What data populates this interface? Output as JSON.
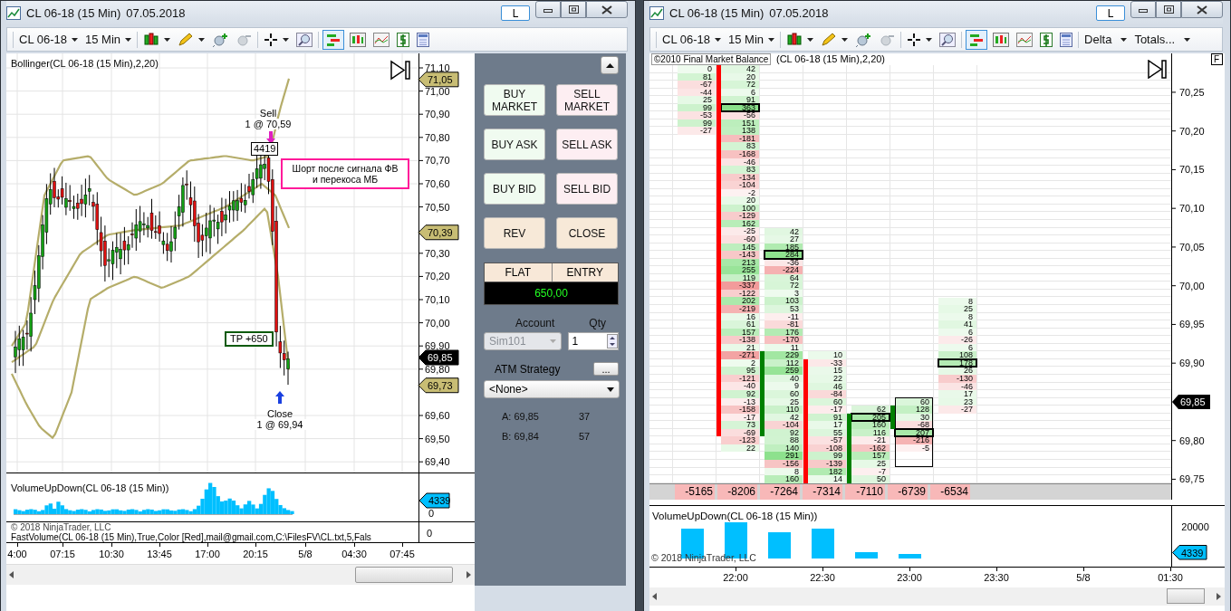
{
  "left_window": {
    "title": "CL 06-18 (15 Min)",
    "date": "07.05.2018",
    "layout_button": "L",
    "toolbar": {
      "instrument": "CL 06-18",
      "interval": "15 Min"
    },
    "price_panel": {
      "indicator": "Bollinger(CL 06-18 (15 Min),2,20)",
      "axis_labels": [
        "71,10",
        "71,00",
        "70,90",
        "70,80",
        "70,70",
        "70,60",
        "70,50",
        "70,30",
        "70,20",
        "70,10",
        "70,00",
        "69,90",
        "69,80",
        "69,60",
        "69,50",
        "69,40"
      ],
      "price_tags": [
        {
          "text": "71,05",
          "color": "#c8bd74"
        },
        {
          "text": "70,39",
          "color": "#c8bd74"
        },
        {
          "text": "69,85",
          "color": "#000000"
        },
        {
          "text": "69,73",
          "color": "#c8bd74"
        }
      ],
      "trades": [
        {
          "kind": "sell",
          "action": "Sell",
          "fill": "1 @ 70,59"
        },
        {
          "kind": "close",
          "action": "Close",
          "fill": "1 @ 69,94"
        }
      ],
      "volume_box": "4419",
      "note": "Шорт после сигнала ФВ\nи перекоса МБ",
      "target": "TP +650"
    },
    "volume_panel": {
      "label": "VolumeUpDown(CL 06-18 (15 Min))",
      "tag": "4339",
      "zero": "0"
    },
    "fastvolume_panel": {
      "copyright": "© 2018 NinjaTrader, LLC",
      "label": "FastVolume(CL 06-18 (15 Min),True,Color [Red],mail@gmail.com,C:\\FilesFV\\CL.txt,5,Fals",
      "zero": "0"
    },
    "time_axis": [
      "4:00",
      "07:15",
      "10:30",
      "13:45",
      "17:00",
      "20:15",
      "5/8",
      "04:30",
      "07:45"
    ]
  },
  "order_panel": {
    "buttons": [
      {
        "label": "BUY MARKET",
        "kind": "buy"
      },
      {
        "label": "SELL MARKET",
        "kind": "sell"
      },
      {
        "label": "BUY ASK",
        "kind": "buy"
      },
      {
        "label": "SELL ASK",
        "kind": "sell"
      },
      {
        "label": "BUY BID",
        "kind": "buy"
      },
      {
        "label": "SELL BID",
        "kind": "sell"
      },
      {
        "label": "REV",
        "kind": "neutral"
      },
      {
        "label": "CLOSE",
        "kind": "neutral"
      }
    ],
    "position": {
      "status": "FLAT",
      "mode": "ENTRY",
      "pnl": "650,00"
    },
    "account": {
      "label": "Account",
      "value": "Sim101",
      "disabled": true
    },
    "quantity": {
      "label": "Qty",
      "value": "1"
    },
    "atm": {
      "label": "ATM Strategy",
      "more": "...",
      "value": "<None>"
    },
    "quotes": [
      {
        "price": "A: 69,85",
        "size": "37"
      },
      {
        "price": "B: 69,84",
        "size": "57"
      }
    ]
  },
  "right_window": {
    "title": "CL 06-18 (15 Min)",
    "date": "07.05.2018",
    "layout_button": "L",
    "toolbar": {
      "instrument": "CL 06-18",
      "interval": "15 Min",
      "view": "Delta",
      "totals": "Totals..."
    },
    "header": {
      "tooltip": "©2010 Final Market Balance",
      "indicator": "(CL 06-18 (15 Min),2,20)",
      "flag": "F"
    },
    "footprint": {
      "columns": [
        {
          "cells": [
            {
              "text": "0",
              "boxed": false
            },
            {
              "text": "81",
              "boxed": false
            },
            {
              "text": "-67",
              "boxed": false
            },
            {
              "text": "-44",
              "boxed": false
            },
            {
              "text": "25",
              "boxed": false
            },
            {
              "text": "99",
              "boxed": false
            },
            {
              "text": "-53",
              "boxed": false
            },
            {
              "text": "99",
              "boxed": false
            },
            {
              "text": "-27",
              "boxed": false
            }
          ]
        },
        {
          "color": "#ff0000",
          "cells": [
            {
              "text": "42",
              "boxed": false
            },
            {
              "text": "20",
              "boxed": false
            },
            {
              "text": "72",
              "boxed": false
            },
            {
              "text": "6",
              "boxed": false
            },
            {
              "text": "91",
              "boxed": false
            },
            {
              "text": "363",
              "boxed": true
            },
            {
              "text": "-56",
              "boxed": false
            },
            {
              "text": "151",
              "boxed": false
            },
            {
              "text": "138",
              "boxed": false
            },
            {
              "text": "-181",
              "boxed": false
            },
            {
              "text": "83",
              "boxed": false
            },
            {
              "text": "-168",
              "boxed": false
            },
            {
              "text": "-46",
              "boxed": false
            },
            {
              "text": "83",
              "boxed": false
            },
            {
              "text": "-134",
              "boxed": false
            },
            {
              "text": "-104",
              "boxed": false
            },
            {
              "text": "-2",
              "boxed": false
            },
            {
              "text": "20",
              "boxed": false
            },
            {
              "text": "100",
              "boxed": false
            },
            {
              "text": "-129",
              "boxed": false
            },
            {
              "text": "162",
              "boxed": false
            },
            {
              "text": "-25",
              "boxed": false
            },
            {
              "text": "-60",
              "boxed": false
            },
            {
              "text": "145",
              "boxed": false
            },
            {
              "text": "-143",
              "boxed": false
            },
            {
              "text": "213",
              "boxed": false
            },
            {
              "text": "255",
              "boxed": false
            },
            {
              "text": "119",
              "boxed": false
            },
            {
              "text": "-337",
              "boxed": false
            },
            {
              "text": "-122",
              "boxed": false
            },
            {
              "text": "202",
              "boxed": false
            },
            {
              "text": "-219",
              "boxed": false
            },
            {
              "text": "16",
              "boxed": false
            },
            {
              "text": "61",
              "boxed": false
            },
            {
              "text": "157",
              "boxed": false
            },
            {
              "text": "-138",
              "boxed": false
            },
            {
              "text": "21",
              "boxed": false
            },
            {
              "text": "-271",
              "boxed": false
            },
            {
              "text": "2",
              "boxed": false
            },
            {
              "text": "95",
              "boxed": false
            },
            {
              "text": "-121",
              "boxed": false
            },
            {
              "text": "-40",
              "boxed": false
            },
            {
              "text": "92",
              "boxed": false
            },
            {
              "text": "-13",
              "boxed": false
            },
            {
              "text": "-158",
              "boxed": false
            },
            {
              "text": "-17",
              "boxed": false
            },
            {
              "text": "73",
              "boxed": false
            },
            {
              "text": "-69",
              "boxed": false
            },
            {
              "text": "-123",
              "boxed": false
            },
            {
              "text": "22",
              "boxed": false
            }
          ]
        },
        {
          "color": "#008000",
          "cells": [
            {
              "text": "42",
              "boxed": false
            },
            {
              "text": "27",
              "boxed": false
            },
            {
              "text": "185",
              "boxed": false
            },
            {
              "text": "284",
              "boxed": true
            },
            {
              "text": "-36",
              "boxed": false
            },
            {
              "text": "-224",
              "boxed": false
            },
            {
              "text": "64",
              "boxed": false
            },
            {
              "text": "72",
              "boxed": false
            },
            {
              "text": "3",
              "boxed": false
            },
            {
              "text": "103",
              "boxed": false
            },
            {
              "text": "53",
              "boxed": false
            },
            {
              "text": "-11",
              "boxed": false
            },
            {
              "text": "-81",
              "boxed": false
            },
            {
              "text": "176",
              "boxed": false
            },
            {
              "text": "-170",
              "boxed": false
            },
            {
              "text": "11",
              "boxed": false
            },
            {
              "text": "229",
              "boxed": false
            },
            {
              "text": "112",
              "boxed": false
            },
            {
              "text": "259",
              "boxed": false
            },
            {
              "text": "40",
              "boxed": false
            },
            {
              "text": "9",
              "boxed": false
            },
            {
              "text": "60",
              "boxed": false
            },
            {
              "text": "25",
              "boxed": false
            },
            {
              "text": "110",
              "boxed": false
            },
            {
              "text": "42",
              "boxed": false
            },
            {
              "text": "-104",
              "boxed": false
            },
            {
              "text": "92",
              "boxed": false
            },
            {
              "text": "88",
              "boxed": false
            },
            {
              "text": "140",
              "boxed": false
            },
            {
              "text": "291",
              "boxed": false
            },
            {
              "text": "-156",
              "boxed": false
            },
            {
              "text": "8",
              "boxed": false
            },
            {
              "text": "160",
              "boxed": false
            }
          ]
        },
        {
          "color": "#ff0000",
          "cells": [
            {
              "text": "10",
              "boxed": false
            },
            {
              "text": "-33",
              "boxed": false
            },
            {
              "text": "15",
              "boxed": false
            },
            {
              "text": "22",
              "boxed": false
            },
            {
              "text": "46",
              "boxed": false
            },
            {
              "text": "-84",
              "boxed": false
            },
            {
              "text": "60",
              "boxed": false
            },
            {
              "text": "-17",
              "boxed": false
            },
            {
              "text": "91",
              "boxed": false
            },
            {
              "text": "17",
              "boxed": false
            },
            {
              "text": "55",
              "boxed": false
            },
            {
              "text": "-57",
              "boxed": false
            },
            {
              "text": "-108",
              "boxed": false
            },
            {
              "text": "99",
              "boxed": false
            },
            {
              "text": "-139",
              "boxed": false
            },
            {
              "text": "182",
              "boxed": false
            },
            {
              "text": "14",
              "boxed": false
            }
          ]
        },
        {
          "color": "#008000",
          "cells": [
            {
              "text": "62",
              "boxed": false
            },
            {
              "text": "205",
              "boxed": true
            },
            {
              "text": "160",
              "boxed": false
            },
            {
              "text": "116",
              "boxed": false
            },
            {
              "text": "-21",
              "boxed": false
            },
            {
              "text": "-162",
              "boxed": false
            },
            {
              "text": "157",
              "boxed": false
            },
            {
              "text": "25",
              "boxed": false
            },
            {
              "text": "-7",
              "boxed": false
            },
            {
              "text": "50",
              "boxed": false
            }
          ]
        },
        {
          "color": "#008000",
          "cells": [
            {
              "text": "60",
              "boxed": false
            },
            {
              "text": "128",
              "boxed": false
            },
            {
              "text": "30",
              "boxed": false
            },
            {
              "text": "-68",
              "boxed": false
            },
            {
              "text": "207",
              "boxed": true
            },
            {
              "text": "-216",
              "boxed": false
            },
            {
              "text": "-5",
              "boxed": false
            }
          ]
        },
        {
          "cells": [
            {
              "text": "8",
              "boxed": false
            },
            {
              "text": "25",
              "boxed": false
            },
            {
              "text": "8",
              "boxed": false
            },
            {
              "text": "41",
              "boxed": false
            },
            {
              "text": "6",
              "boxed": false
            },
            {
              "text": "-26",
              "boxed": false
            },
            {
              "text": "6",
              "boxed": false
            },
            {
              "text": "108",
              "boxed": false
            },
            {
              "text": "178",
              "boxed": true
            },
            {
              "text": "26",
              "boxed": false
            },
            {
              "text": "-130",
              "boxed": false
            },
            {
              "text": "-46",
              "boxed": false
            },
            {
              "text": "17",
              "boxed": false
            },
            {
              "text": "23",
              "boxed": false
            },
            {
              "text": "-27",
              "boxed": false
            }
          ]
        }
      ],
      "totals": [
        "-5165",
        "-8206",
        "-7264",
        "-7314",
        "-7110",
        "-6739",
        "-6534"
      ],
      "axis_labels": [
        "70,25",
        "70,20",
        "70,15",
        "70,10",
        "70,05",
        "70,00",
        "69,95",
        "69,90",
        "69,80",
        "69,75"
      ],
      "price_tag": "69,85"
    },
    "volume_panel": {
      "label": "VolumeUpDown(CL 06-18 (15 Min))",
      "tick": "20000",
      "tag": "4339",
      "copyright": "© 2018 NinjaTrader, LLC"
    },
    "time_axis": [
      "22:00",
      "22:30",
      "23:00",
      "23:30",
      "5/8",
      "01:30"
    ]
  }
}
